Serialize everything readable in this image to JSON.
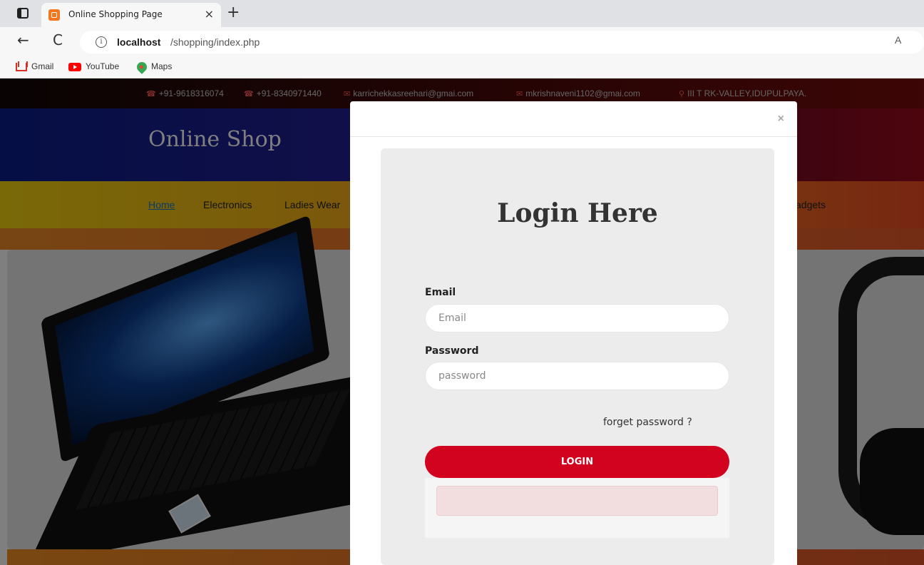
{
  "browser": {
    "tab_title": "Online Shopping Page",
    "tab_close": "×",
    "new_tab": "+",
    "back": "←",
    "reload": "C",
    "info": "i",
    "url_host": "localhost",
    "url_path": "/shopping/index.php",
    "read_aloud": "A",
    "bookmarks": [
      {
        "label": "Gmail",
        "icon": "gmail-icon"
      },
      {
        "label": "YouTube",
        "icon": "youtube-icon"
      },
      {
        "label": "Maps",
        "icon": "maps-icon"
      }
    ]
  },
  "site": {
    "contacts": [
      {
        "icon": "phone-icon",
        "glyph": "☎",
        "text": "+91-9618316074"
      },
      {
        "icon": "phone-icon",
        "glyph": "☎",
        "text": "+91-8340971440"
      },
      {
        "icon": "mail-icon",
        "glyph": "✉",
        "text": "karrichekkasreehari@gmai.com"
      },
      {
        "icon": "mail-icon",
        "glyph": "✉",
        "text": "mkrishnaveni1102@gmai.com"
      },
      {
        "icon": "location-icon",
        "glyph": "⚲",
        "text": "III T RK-VALLEY,IDUPULPAYA."
      }
    ],
    "brand": "Online Shop",
    "nav": [
      "Home",
      "Electronics",
      "Ladies Wear",
      "adgets"
    ]
  },
  "modal": {
    "close": "×",
    "title": "Login Here",
    "email_label": "Email",
    "email_placeholder": "Email",
    "password_label": "Password",
    "password_placeholder": "password",
    "forget": "forget password ?",
    "login_button": "LOGIN"
  },
  "colors": {
    "login_button": "#d1031f",
    "active_nav": "#0f7acd",
    "alert_bg": "#f2dede"
  }
}
